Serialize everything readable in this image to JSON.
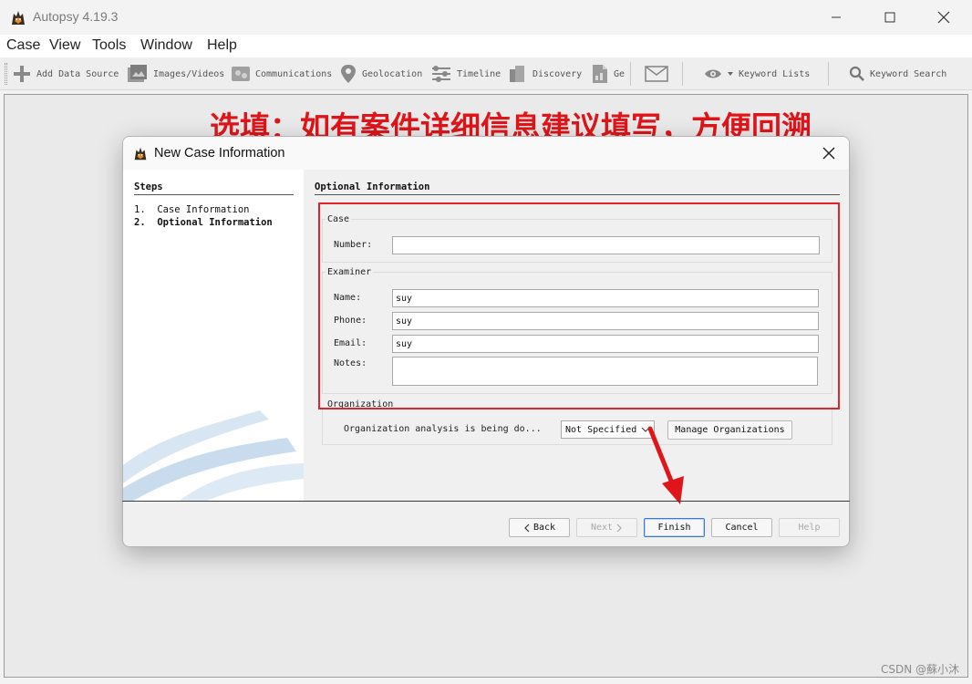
{
  "window": {
    "title": "Autopsy 4.19.3",
    "minimize_icon": "minimize-icon",
    "maximize_icon": "maximize-icon",
    "close_icon": "close-icon"
  },
  "menu": [
    "Case",
    "View",
    "Tools",
    "Window",
    "Help"
  ],
  "toolbar": {
    "items": [
      {
        "label": "Add Data Source",
        "icon": "plus-icon"
      },
      {
        "label": "Images/Videos",
        "icon": "images-icon"
      },
      {
        "label": "Communications",
        "icon": "communications-icon"
      },
      {
        "label": "Geolocation",
        "icon": "map-pin-icon"
      },
      {
        "label": "Timeline",
        "icon": "timeline-icon"
      },
      {
        "label": "Discovery",
        "icon": "discovery-icon"
      },
      {
        "label": "Ge",
        "icon": "report-icon"
      },
      {
        "label": "",
        "icon": "email-icon"
      }
    ],
    "keyword_lists": "Keyword Lists",
    "keyword_search": "Keyword Search"
  },
  "annotation": "选填：如有案件详细信息建议填写，方便回溯",
  "dialog": {
    "title": "New Case Information",
    "steps_heading": "Steps",
    "steps": [
      {
        "number": "1.",
        "label": "Case Information",
        "active": false
      },
      {
        "number": "2.",
        "label": "Optional Information",
        "active": true
      }
    ],
    "content_heading": "Optional Information",
    "case_group": {
      "label": "Case",
      "number_label": "Number:",
      "number_value": ""
    },
    "examiner_group": {
      "label": "Examiner",
      "name_label": "Name:",
      "name_value": "suy",
      "phone_label": "Phone:",
      "phone_value": "suy",
      "email_label": "Email:",
      "email_value": "suy",
      "notes_label": "Notes:",
      "notes_value": ""
    },
    "organization_group": {
      "label": "Organization",
      "analysis_label": "Organization analysis is being do...",
      "selected": "Not Specified",
      "manage_button": "Manage Organizations"
    },
    "buttons": {
      "back": "Back",
      "next": "Next",
      "finish": "Finish",
      "cancel": "Cancel",
      "help": "Help"
    }
  },
  "watermark": "CSDN @蘇小沐",
  "colors": {
    "annotation": "#e0151a",
    "highlight_box": "#e0252a",
    "default_button_border": "#3f78c9"
  }
}
